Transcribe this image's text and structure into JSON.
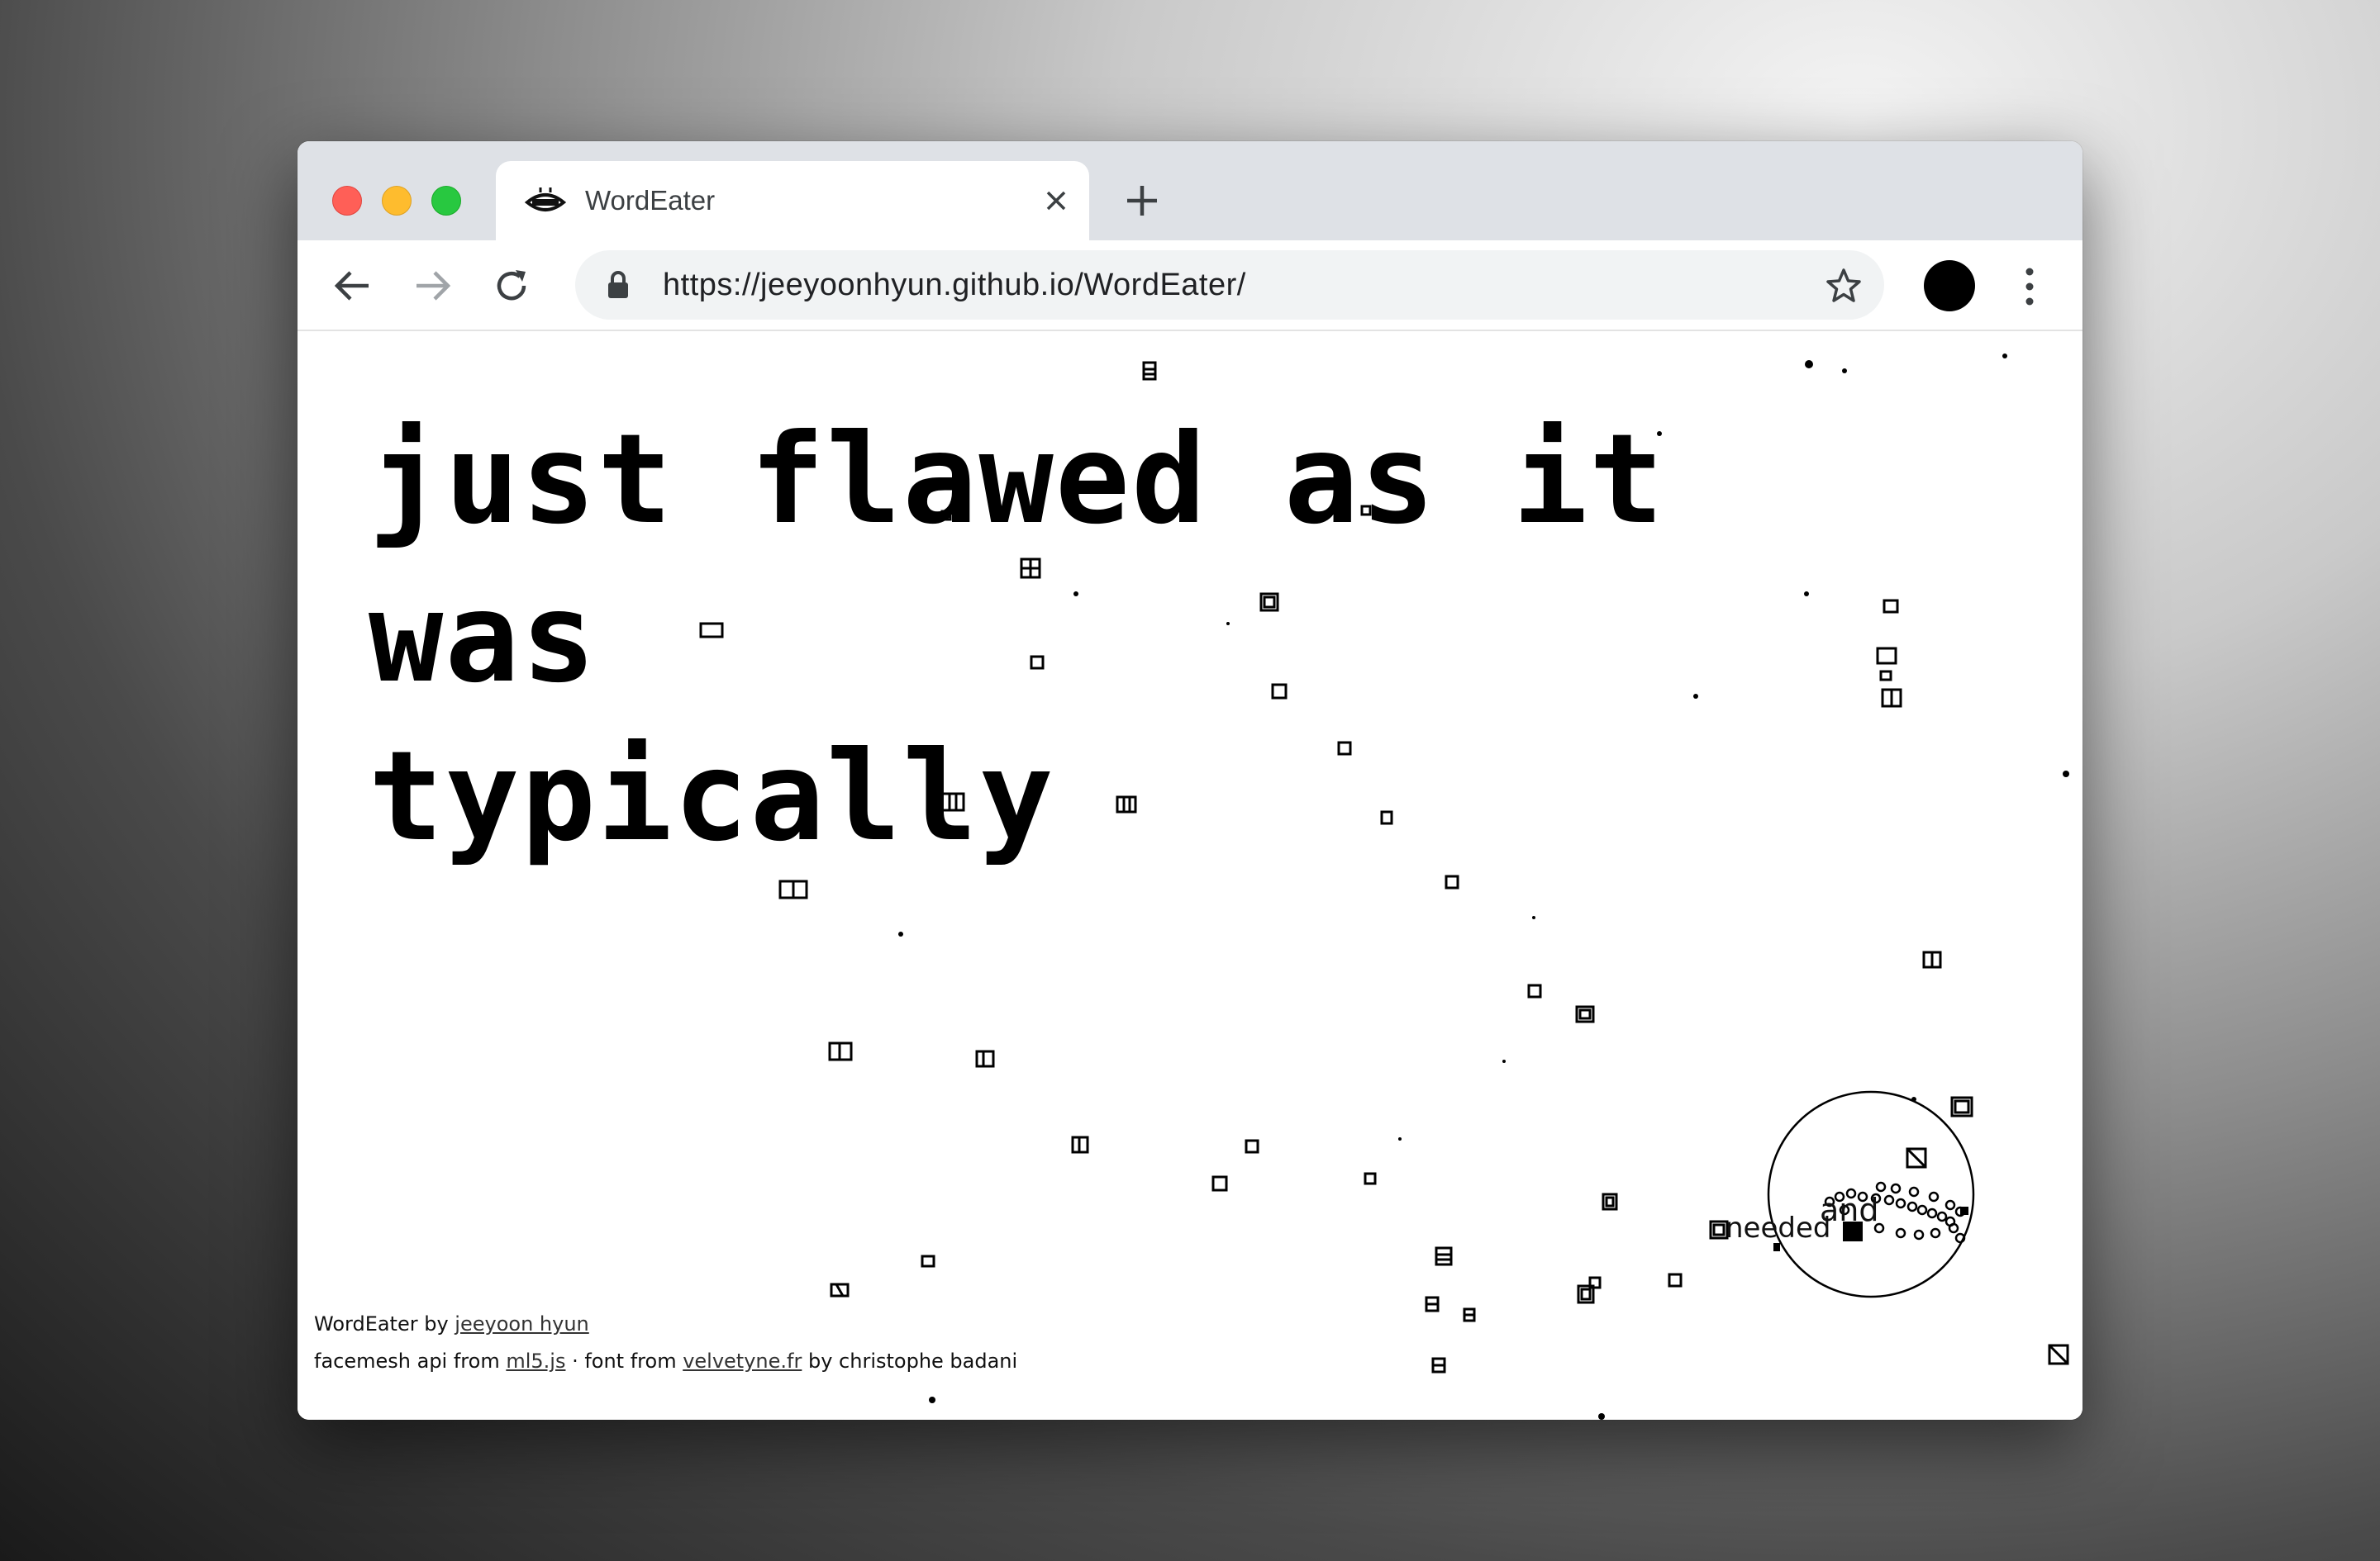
{
  "browser": {
    "tab": {
      "title": "WordEater",
      "favicon": "eye-mouth-icon",
      "close_icon": "close-icon"
    },
    "new_tab_icon": "plus-icon",
    "nav": {
      "back_icon": "arrow-left-icon",
      "forward_icon": "arrow-right-icon",
      "reload_icon": "reload-icon"
    },
    "address": {
      "url": "https://jeeyoonhyun.github.io/WordEater/",
      "lock_icon": "lock-icon",
      "bookmark_icon": "star-icon"
    },
    "profile_icon": "profile-avatar",
    "menu_icon": "more-vert-icon"
  },
  "page": {
    "headline_line1": "just flawed as it was",
    "headline_line2": "typically",
    "floating_words": [
      "and",
      "needed"
    ],
    "credits": {
      "line1_prefix": "WordEater by ",
      "author_link": "jeeyoon hyun",
      "line2_prefix": "facemesh api from ",
      "ml5_link": "ml5.js",
      "line2_mid": " · font from ",
      "font_link": "velvetyne.fr",
      "line2_suffix": " by christophe badani"
    }
  },
  "colors": {
    "tabbar": "#dee1e6",
    "omnibox": "#f1f3f4",
    "traffic_red": "#ff5f57",
    "traffic_yellow": "#febc2e",
    "traffic_green": "#28c840"
  }
}
